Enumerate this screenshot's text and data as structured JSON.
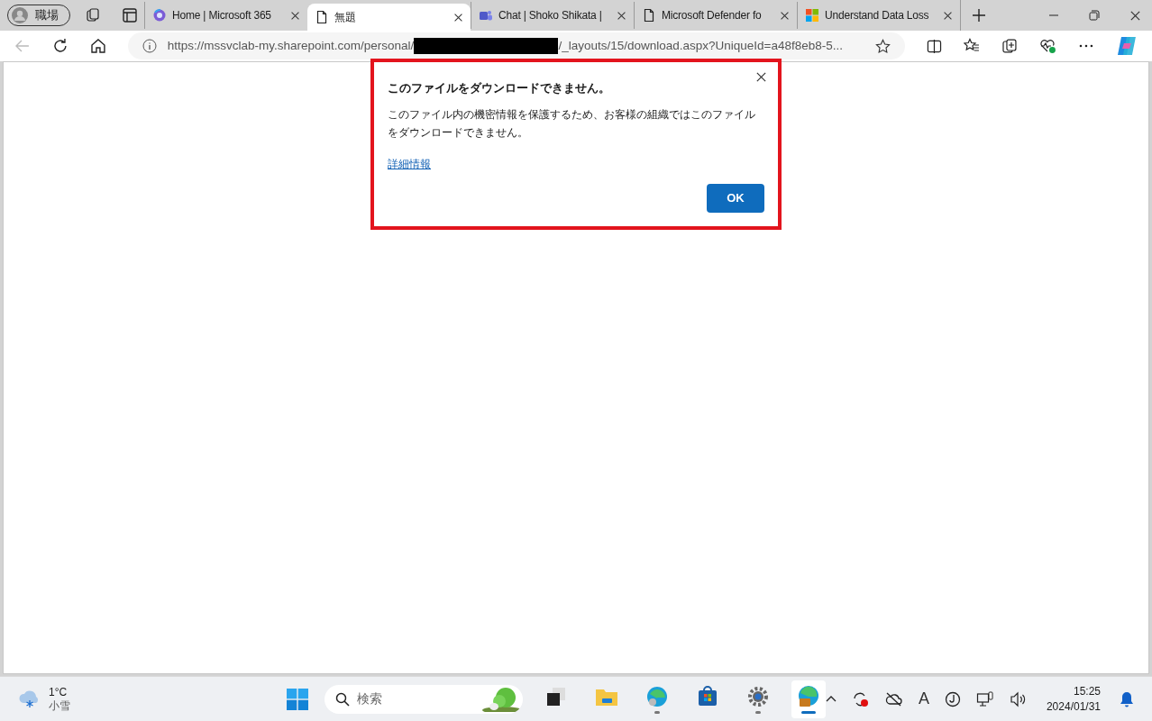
{
  "profile": {
    "label": "職場"
  },
  "tabs": [
    {
      "title": "Home | Microsoft 365",
      "kind": "m365",
      "selected": false
    },
    {
      "title": "無題",
      "kind": "page",
      "selected": true
    },
    {
      "title": "Chat | Shoko Shikata |",
      "kind": "teams",
      "selected": false
    },
    {
      "title": "Microsoft Defender fo",
      "kind": "page",
      "selected": false
    },
    {
      "title": "Understand Data Loss",
      "kind": "ms",
      "selected": false
    }
  ],
  "address": {
    "url_start": "https://mssvclab-my.sharepoint.com/personal/",
    "redacted": true,
    "url_end": "/_layouts/15/download.aspx?UniqueId=a48f8eb8-5..."
  },
  "dialog": {
    "title": "このファイルをダウンロードできません。",
    "message": "このファイル内の機密情報を保護するため、お客様の組織ではこのファイルをダウンロードできません。",
    "link": "詳細情報",
    "ok": "OK"
  },
  "taskbar": {
    "weather": {
      "temp": "1°C",
      "condition": "小雪"
    },
    "search": {
      "placeholder": "検索"
    },
    "apps": [
      {
        "kind": "taskview",
        "running": false,
        "active": false
      },
      {
        "kind": "explorer",
        "running": false,
        "active": false
      },
      {
        "kind": "edge",
        "running": true,
        "active": false
      },
      {
        "kind": "store",
        "running": false,
        "active": false
      },
      {
        "kind": "settings",
        "running": true,
        "active": false
      },
      {
        "kind": "edge-work",
        "running": true,
        "active": true
      }
    ],
    "ime": "A",
    "time": "15:25",
    "date": "2024/01/31"
  }
}
